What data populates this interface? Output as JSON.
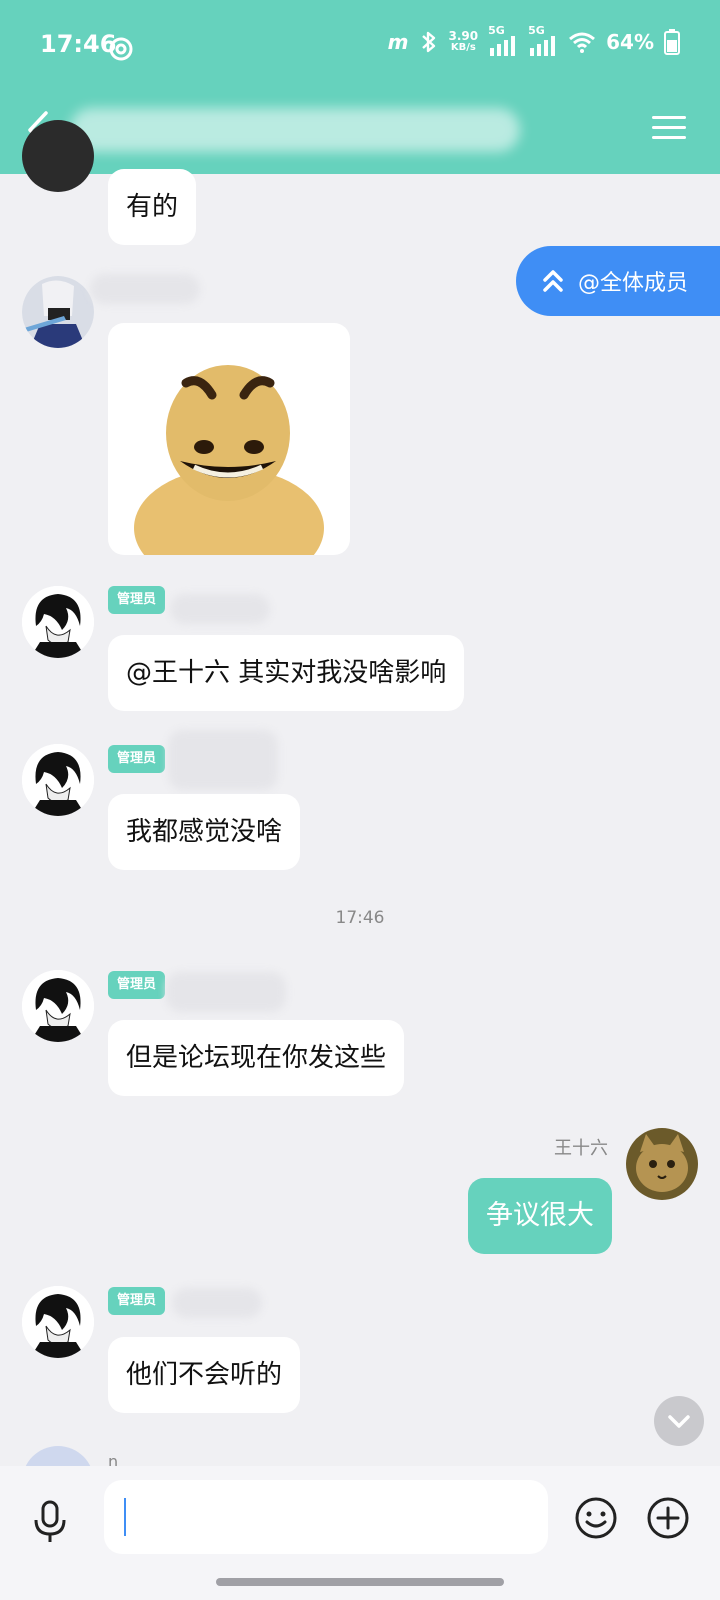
{
  "status_bar": {
    "time": "17:46",
    "net_speed": "3.90",
    "net_unit": "KB/s",
    "sig1": "5G",
    "sig2": "5G",
    "battery": "64%"
  },
  "header": {
    "title": ""
  },
  "at_all_label": "@全体成员",
  "admin_badge": "管理员",
  "messages": [
    {
      "text": "有的"
    },
    {
      "text": "@王十六 其实对我没啥影响"
    },
    {
      "text": "我都感觉没啥"
    },
    {
      "text": "但是论坛现在你发这些"
    },
    {
      "text": "争议很大",
      "sender": "王十六"
    },
    {
      "text": "他们不会听的"
    }
  ],
  "time_divider": "17:46",
  "partial_sender": "n",
  "colors": {
    "accent": "#66d2bd",
    "mention_blue": "#3f8ef5"
  }
}
